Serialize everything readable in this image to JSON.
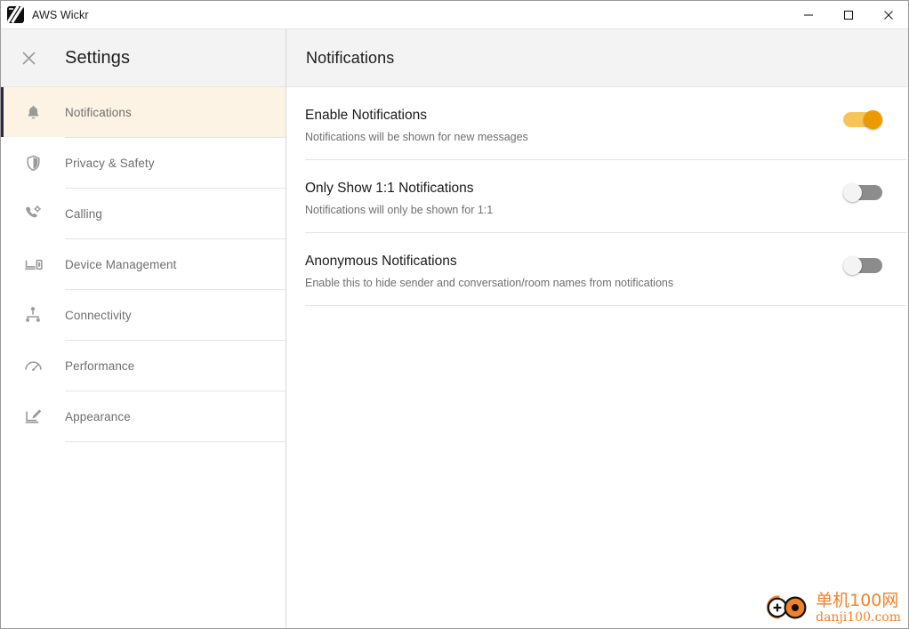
{
  "window": {
    "app_title": "AWS Wickr",
    "app_icon": "wickr-logo-icon",
    "controls": {
      "minimize": "minimize-button",
      "maximize": "maximize-button",
      "close": "close-button"
    }
  },
  "sidebar": {
    "close_icon": "close-icon",
    "title": "Settings",
    "items": [
      {
        "label": "Notifications",
        "icon": "bell-icon",
        "active": true
      },
      {
        "label": "Privacy & Safety",
        "icon": "shield-icon",
        "active": false
      },
      {
        "label": "Calling",
        "icon": "phone-gear-icon",
        "active": false
      },
      {
        "label": "Device Management",
        "icon": "devices-icon",
        "active": false
      },
      {
        "label": "Connectivity",
        "icon": "network-icon",
        "active": false
      },
      {
        "label": "Performance",
        "icon": "gauge-icon",
        "active": false
      },
      {
        "label": "Appearance",
        "icon": "edit-panel-icon",
        "active": false
      }
    ]
  },
  "content": {
    "title": "Notifications",
    "settings": [
      {
        "label": "Enable Notifications",
        "description": "Notifications will be shown for new messages",
        "toggle_state": "on"
      },
      {
        "label": "Only Show 1:1 Notifications",
        "description": "Notifications will only be shown for 1:1",
        "toggle_state": "off"
      },
      {
        "label": "Anonymous Notifications",
        "description": "Enable this to hide sender and conversation/room names from notifications",
        "toggle_state": "off"
      }
    ]
  },
  "watermark": {
    "cn_text": "单机100网",
    "en_text": "danji100.com"
  },
  "colors": {
    "accent_orange": "#ed9a00",
    "toggle_track_on": "#f7c555",
    "toggle_track_off": "#8c8c8c",
    "active_row_bg": "#fdf3e4",
    "active_marker": "#2b2a45",
    "header_bg": "#f3f3f3",
    "watermark_orange": "#f2822a"
  }
}
